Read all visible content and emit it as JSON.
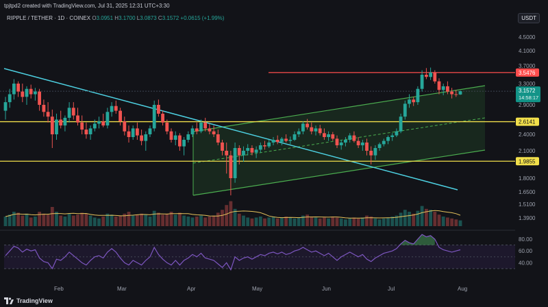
{
  "header": {
    "credit": "tpjtpd2 created with TradingView.com, Jul 31, 2025 12:31 UTC+3:30",
    "symbol": "RIPPLE / TETHER · 1D · COINEX",
    "ohlc": [
      {
        "key": "O",
        "value": "3.0951"
      },
      {
        "key": "H",
        "value": "3.1700"
      },
      {
        "key": "L",
        "value": "3.0873"
      },
      {
        "key": "C",
        "value": "3.1572"
      }
    ],
    "change": "+0.0615 (+1.99%)",
    "currency": "USDT"
  },
  "footer": {
    "brand_icon": "tradingview-logo-icon",
    "brand": "TradingView"
  },
  "colors": {
    "background": "#121318",
    "up": "#26a69a",
    "down": "#ef5350",
    "channel": "#4caf50",
    "trendline": "#4dd0e1",
    "support": "#f2e04b",
    "resistance": "#ff4d4d",
    "rsi": "#7e57c2"
  },
  "chart_data": {
    "type": "candlestick",
    "price_axis_ticks": [
      "4.5000",
      "4.1000",
      "3.7000",
      "3.3000",
      "2.9000",
      "2.4000",
      "2.1000",
      "1.8000",
      "1.6500",
      "1.5100",
      "1.3900"
    ],
    "x_ticks": [
      "Feb",
      "Mar",
      "Apr",
      "May",
      "Jun",
      "Jul",
      "Aug"
    ],
    "levels": [
      {
        "label": "3.5476",
        "kind": "resistance",
        "value": 3.5476
      },
      {
        "label": "2.6141",
        "kind": "support",
        "value": 2.6141
      },
      {
        "label": "1.9855",
        "kind": "support",
        "value": 1.9855
      }
    ],
    "last_price": {
      "label": "3.1572",
      "value": 3.1572,
      "countdown": "14:58:17"
    },
    "ohlc_series": [
      {
        "o": 2.8,
        "h": 3.05,
        "l": 2.65,
        "c": 2.95
      },
      {
        "o": 2.95,
        "h": 3.2,
        "l": 2.85,
        "c": 3.1
      },
      {
        "o": 3.1,
        "h": 3.4,
        "l": 3.0,
        "c": 3.3
      },
      {
        "o": 3.3,
        "h": 3.35,
        "l": 3.05,
        "c": 3.15
      },
      {
        "o": 3.15,
        "h": 3.3,
        "l": 2.95,
        "c": 3.05
      },
      {
        "o": 3.05,
        "h": 3.25,
        "l": 2.9,
        "c": 3.2
      },
      {
        "o": 3.2,
        "h": 3.28,
        "l": 3.02,
        "c": 3.1
      },
      {
        "o": 3.1,
        "h": 3.22,
        "l": 2.98,
        "c": 3.15
      },
      {
        "o": 3.15,
        "h": 3.2,
        "l": 2.8,
        "c": 2.9
      },
      {
        "o": 2.9,
        "h": 3.0,
        "l": 2.7,
        "c": 2.78
      },
      {
        "o": 2.78,
        "h": 2.95,
        "l": 2.6,
        "c": 2.7
      },
      {
        "o": 2.7,
        "h": 2.82,
        "l": 2.15,
        "c": 2.4
      },
      {
        "o": 2.4,
        "h": 2.75,
        "l": 2.3,
        "c": 2.65
      },
      {
        "o": 2.65,
        "h": 2.8,
        "l": 2.5,
        "c": 2.55
      },
      {
        "o": 2.55,
        "h": 2.72,
        "l": 2.45,
        "c": 2.68
      },
      {
        "o": 2.68,
        "h": 2.95,
        "l": 2.6,
        "c": 2.85
      },
      {
        "o": 2.85,
        "h": 2.95,
        "l": 2.65,
        "c": 2.72
      },
      {
        "o": 2.72,
        "h": 2.85,
        "l": 2.55,
        "c": 2.6
      },
      {
        "o": 2.6,
        "h": 2.72,
        "l": 2.4,
        "c": 2.48
      },
      {
        "o": 2.48,
        "h": 2.6,
        "l": 2.32,
        "c": 2.4
      },
      {
        "o": 2.4,
        "h": 2.55,
        "l": 2.3,
        "c": 2.5
      },
      {
        "o": 2.5,
        "h": 2.65,
        "l": 2.45,
        "c": 2.58
      },
      {
        "o": 2.58,
        "h": 2.7,
        "l": 2.5,
        "c": 2.62
      },
      {
        "o": 2.62,
        "h": 2.75,
        "l": 2.52,
        "c": 2.55
      },
      {
        "o": 2.55,
        "h": 2.85,
        "l": 2.5,
        "c": 2.78
      },
      {
        "o": 2.78,
        "h": 2.95,
        "l": 2.7,
        "c": 2.88
      },
      {
        "o": 2.88,
        "h": 2.98,
        "l": 2.75,
        "c": 2.8
      },
      {
        "o": 2.8,
        "h": 2.85,
        "l": 2.55,
        "c": 2.62
      },
      {
        "o": 2.62,
        "h": 2.7,
        "l": 2.38,
        "c": 2.45
      },
      {
        "o": 2.45,
        "h": 2.55,
        "l": 2.25,
        "c": 2.35
      },
      {
        "o": 2.35,
        "h": 2.55,
        "l": 2.3,
        "c": 2.5
      },
      {
        "o": 2.5,
        "h": 2.6,
        "l": 2.3,
        "c": 2.38
      },
      {
        "o": 2.38,
        "h": 2.48,
        "l": 2.2,
        "c": 2.28
      },
      {
        "o": 2.28,
        "h": 2.45,
        "l": 2.1,
        "c": 2.4
      },
      {
        "o": 2.4,
        "h": 2.55,
        "l": 2.35,
        "c": 2.5
      },
      {
        "o": 2.5,
        "h": 2.98,
        "l": 2.45,
        "c": 2.9
      },
      {
        "o": 2.9,
        "h": 3.0,
        "l": 2.7,
        "c": 2.75
      },
      {
        "o": 2.75,
        "h": 2.8,
        "l": 2.55,
        "c": 2.6
      },
      {
        "o": 2.6,
        "h": 2.65,
        "l": 2.4,
        "c": 2.45
      },
      {
        "o": 2.45,
        "h": 2.5,
        "l": 2.25,
        "c": 2.3
      },
      {
        "o": 2.3,
        "h": 2.45,
        "l": 2.2,
        "c": 2.38
      },
      {
        "o": 2.38,
        "h": 2.42,
        "l": 2.1,
        "c": 2.18
      },
      {
        "o": 2.18,
        "h": 2.35,
        "l": 2.05,
        "c": 2.3
      },
      {
        "o": 2.3,
        "h": 2.45,
        "l": 2.25,
        "c": 2.4
      },
      {
        "o": 2.4,
        "h": 2.55,
        "l": 2.35,
        "c": 2.5
      },
      {
        "o": 2.5,
        "h": 2.6,
        "l": 2.4,
        "c": 2.45
      },
      {
        "o": 2.45,
        "h": 2.65,
        "l": 2.42,
        "c": 2.6
      },
      {
        "o": 2.6,
        "h": 2.68,
        "l": 2.45,
        "c": 2.5
      },
      {
        "o": 2.5,
        "h": 2.58,
        "l": 2.4,
        "c": 2.45
      },
      {
        "o": 2.45,
        "h": 2.55,
        "l": 2.35,
        "c": 2.4
      },
      {
        "o": 2.4,
        "h": 2.48,
        "l": 2.2,
        "c": 2.25
      },
      {
        "o": 2.25,
        "h": 2.3,
        "l": 2.05,
        "c": 2.1
      },
      {
        "o": 2.1,
        "h": 2.25,
        "l": 1.85,
        "c": 2.05
      },
      {
        "o": 2.05,
        "h": 2.1,
        "l": 1.61,
        "c": 1.8
      },
      {
        "o": 1.8,
        "h": 2.25,
        "l": 1.75,
        "c": 2.15
      },
      {
        "o": 2.15,
        "h": 2.2,
        "l": 1.95,
        "c": 2.05
      },
      {
        "o": 2.05,
        "h": 2.18,
        "l": 1.98,
        "c": 2.1
      },
      {
        "o": 2.1,
        "h": 2.22,
        "l": 2.05,
        "c": 2.15
      },
      {
        "o": 2.15,
        "h": 2.2,
        "l": 2.05,
        "c": 2.08
      },
      {
        "o": 2.08,
        "h": 2.18,
        "l": 2.02,
        "c": 2.12
      },
      {
        "o": 2.12,
        "h": 2.25,
        "l": 2.08,
        "c": 2.2
      },
      {
        "o": 2.2,
        "h": 2.28,
        "l": 2.12,
        "c": 2.18
      },
      {
        "o": 2.18,
        "h": 2.3,
        "l": 2.15,
        "c": 2.25
      },
      {
        "o": 2.25,
        "h": 2.35,
        "l": 2.2,
        "c": 2.3
      },
      {
        "o": 2.3,
        "h": 2.38,
        "l": 2.22,
        "c": 2.26
      },
      {
        "o": 2.26,
        "h": 2.35,
        "l": 2.2,
        "c": 2.32
      },
      {
        "o": 2.32,
        "h": 2.4,
        "l": 2.25,
        "c": 2.28
      },
      {
        "o": 2.28,
        "h": 2.36,
        "l": 2.22,
        "c": 2.3
      },
      {
        "o": 2.3,
        "h": 2.45,
        "l": 2.28,
        "c": 2.4
      },
      {
        "o": 2.4,
        "h": 2.5,
        "l": 2.35,
        "c": 2.45
      },
      {
        "o": 2.45,
        "h": 2.62,
        "l": 2.4,
        "c": 2.58
      },
      {
        "o": 2.58,
        "h": 2.66,
        "l": 2.48,
        "c": 2.52
      },
      {
        "o": 2.52,
        "h": 2.6,
        "l": 2.4,
        "c": 2.45
      },
      {
        "o": 2.45,
        "h": 2.55,
        "l": 2.38,
        "c": 2.5
      },
      {
        "o": 2.5,
        "h": 2.56,
        "l": 2.38,
        "c": 2.42
      },
      {
        "o": 2.42,
        "h": 2.5,
        "l": 2.3,
        "c": 2.35
      },
      {
        "o": 2.35,
        "h": 2.45,
        "l": 2.28,
        "c": 2.4
      },
      {
        "o": 2.4,
        "h": 2.44,
        "l": 2.28,
        "c": 2.32
      },
      {
        "o": 2.32,
        "h": 2.38,
        "l": 2.15,
        "c": 2.2
      },
      {
        "o": 2.2,
        "h": 2.3,
        "l": 2.12,
        "c": 2.25
      },
      {
        "o": 2.25,
        "h": 2.35,
        "l": 2.18,
        "c": 2.3
      },
      {
        "o": 2.3,
        "h": 2.42,
        "l": 2.25,
        "c": 2.38
      },
      {
        "o": 2.38,
        "h": 2.45,
        "l": 2.25,
        "c": 2.28
      },
      {
        "o": 2.28,
        "h": 2.35,
        "l": 2.15,
        "c": 2.2
      },
      {
        "o": 2.2,
        "h": 2.3,
        "l": 2.1,
        "c": 2.25
      },
      {
        "o": 2.25,
        "h": 2.32,
        "l": 2.05,
        "c": 2.1
      },
      {
        "o": 2.1,
        "h": 2.18,
        "l": 1.95,
        "c": 2.05
      },
      {
        "o": 2.05,
        "h": 2.2,
        "l": 2.0,
        "c": 2.15
      },
      {
        "o": 2.15,
        "h": 2.25,
        "l": 2.1,
        "c": 2.22
      },
      {
        "o": 2.22,
        "h": 2.32,
        "l": 2.18,
        "c": 2.28
      },
      {
        "o": 2.28,
        "h": 2.38,
        "l": 2.22,
        "c": 2.35
      },
      {
        "o": 2.35,
        "h": 2.42,
        "l": 2.28,
        "c": 2.38
      },
      {
        "o": 2.38,
        "h": 2.5,
        "l": 2.35,
        "c": 2.45
      },
      {
        "o": 2.45,
        "h": 2.75,
        "l": 2.42,
        "c": 2.7
      },
      {
        "o": 2.7,
        "h": 2.98,
        "l": 2.65,
        "c": 2.92
      },
      {
        "o": 2.92,
        "h": 3.1,
        "l": 2.85,
        "c": 3.0
      },
      {
        "o": 3.0,
        "h": 3.05,
        "l": 2.88,
        "c": 2.95
      },
      {
        "o": 2.95,
        "h": 3.25,
        "l": 2.9,
        "c": 3.2
      },
      {
        "o": 3.2,
        "h": 3.6,
        "l": 3.15,
        "c": 3.5
      },
      {
        "o": 3.5,
        "h": 3.65,
        "l": 3.4,
        "c": 3.45
      },
      {
        "o": 3.45,
        "h": 3.66,
        "l": 3.38,
        "c": 3.55
      },
      {
        "o": 3.55,
        "h": 3.6,
        "l": 3.3,
        "c": 3.35
      },
      {
        "o": 3.35,
        "h": 3.42,
        "l": 3.1,
        "c": 3.18
      },
      {
        "o": 3.18,
        "h": 3.3,
        "l": 3.08,
        "c": 3.25
      },
      {
        "o": 3.25,
        "h": 3.35,
        "l": 3.1,
        "c": 3.15
      },
      {
        "o": 3.15,
        "h": 3.22,
        "l": 3.02,
        "c": 3.1
      },
      {
        "o": 3.1,
        "h": 3.18,
        "l": 3.05,
        "c": 3.0951
      },
      {
        "o": 3.0951,
        "h": 3.17,
        "l": 3.0873,
        "c": 3.1572
      }
    ],
    "rsi_axis_ticks": [
      "80.00",
      "60.00",
      "40.00"
    ],
    "rsi_values": [
      52,
      60,
      68,
      65,
      58,
      63,
      60,
      62,
      48,
      42,
      40,
      30,
      46,
      44,
      50,
      58,
      52,
      46,
      40,
      36,
      44,
      50,
      52,
      48,
      58,
      64,
      58,
      48,
      40,
      36,
      44,
      40,
      36,
      44,
      50,
      66,
      54,
      46,
      40,
      36,
      44,
      36,
      44,
      48,
      54,
      50,
      56,
      48,
      46,
      44,
      38,
      32,
      40,
      28,
      50,
      44,
      48,
      50,
      46,
      50,
      54,
      52,
      56,
      58,
      55,
      58,
      54,
      56,
      60,
      62,
      66,
      62,
      58,
      60,
      56,
      52,
      56,
      50,
      44,
      50,
      54,
      58,
      54,
      50,
      54,
      46,
      42,
      48,
      52,
      56,
      58,
      60,
      64,
      72,
      78,
      74,
      72,
      80,
      88,
      84,
      86,
      80,
      66,
      62,
      60,
      58,
      60,
      62
    ],
    "volume": [
      20,
      24,
      30,
      28,
      22,
      26,
      18,
      20,
      30,
      26,
      24,
      40,
      30,
      22,
      20,
      26,
      22,
      24,
      28,
      26,
      22,
      18,
      16,
      20,
      26,
      24,
      20,
      22,
      26,
      30,
      22,
      24,
      26,
      24,
      20,
      32,
      28,
      24,
      26,
      30,
      24,
      28,
      22,
      20,
      18,
      20,
      22,
      18,
      20,
      22,
      28,
      34,
      44,
      52,
      36,
      26,
      22,
      18,
      16,
      18,
      20,
      16,
      18,
      20,
      16,
      18,
      20,
      18,
      16,
      18,
      22,
      24,
      20,
      18,
      16,
      18,
      16,
      20,
      18,
      16,
      14,
      16,
      18,
      16,
      18,
      22,
      20,
      16,
      14,
      16,
      18,
      20,
      22,
      28,
      34,
      30,
      26,
      32,
      42,
      36,
      34,
      30,
      24,
      20,
      18,
      16,
      14,
      12
    ]
  }
}
